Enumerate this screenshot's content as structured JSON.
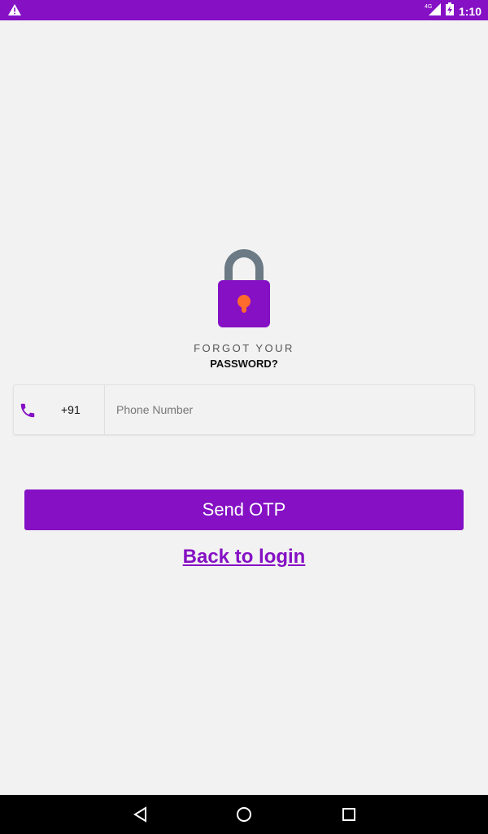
{
  "status_bar": {
    "time": "1:10",
    "network": "4G",
    "icons": [
      "warning-icon",
      "signal-icon",
      "battery-charging-icon"
    ]
  },
  "lock_icon": "padlock-icon",
  "heading": {
    "line1": "FORGOT YOUR",
    "line2": "PASSWORD?"
  },
  "phone_field": {
    "icon": "phone-icon",
    "country_code": "+91",
    "placeholder": "Phone Number",
    "value": ""
  },
  "send_button": {
    "label": "Send OTP"
  },
  "back_link": {
    "label": "Back to login"
  },
  "nav_bar": {
    "icons": [
      "back-icon",
      "home-icon",
      "recents-icon"
    ]
  },
  "colors": {
    "accent": "#8510c4",
    "lock_shackle": "#6b7a84",
    "keyhole": "#ff6b2c",
    "background": "#f2f2f2"
  }
}
